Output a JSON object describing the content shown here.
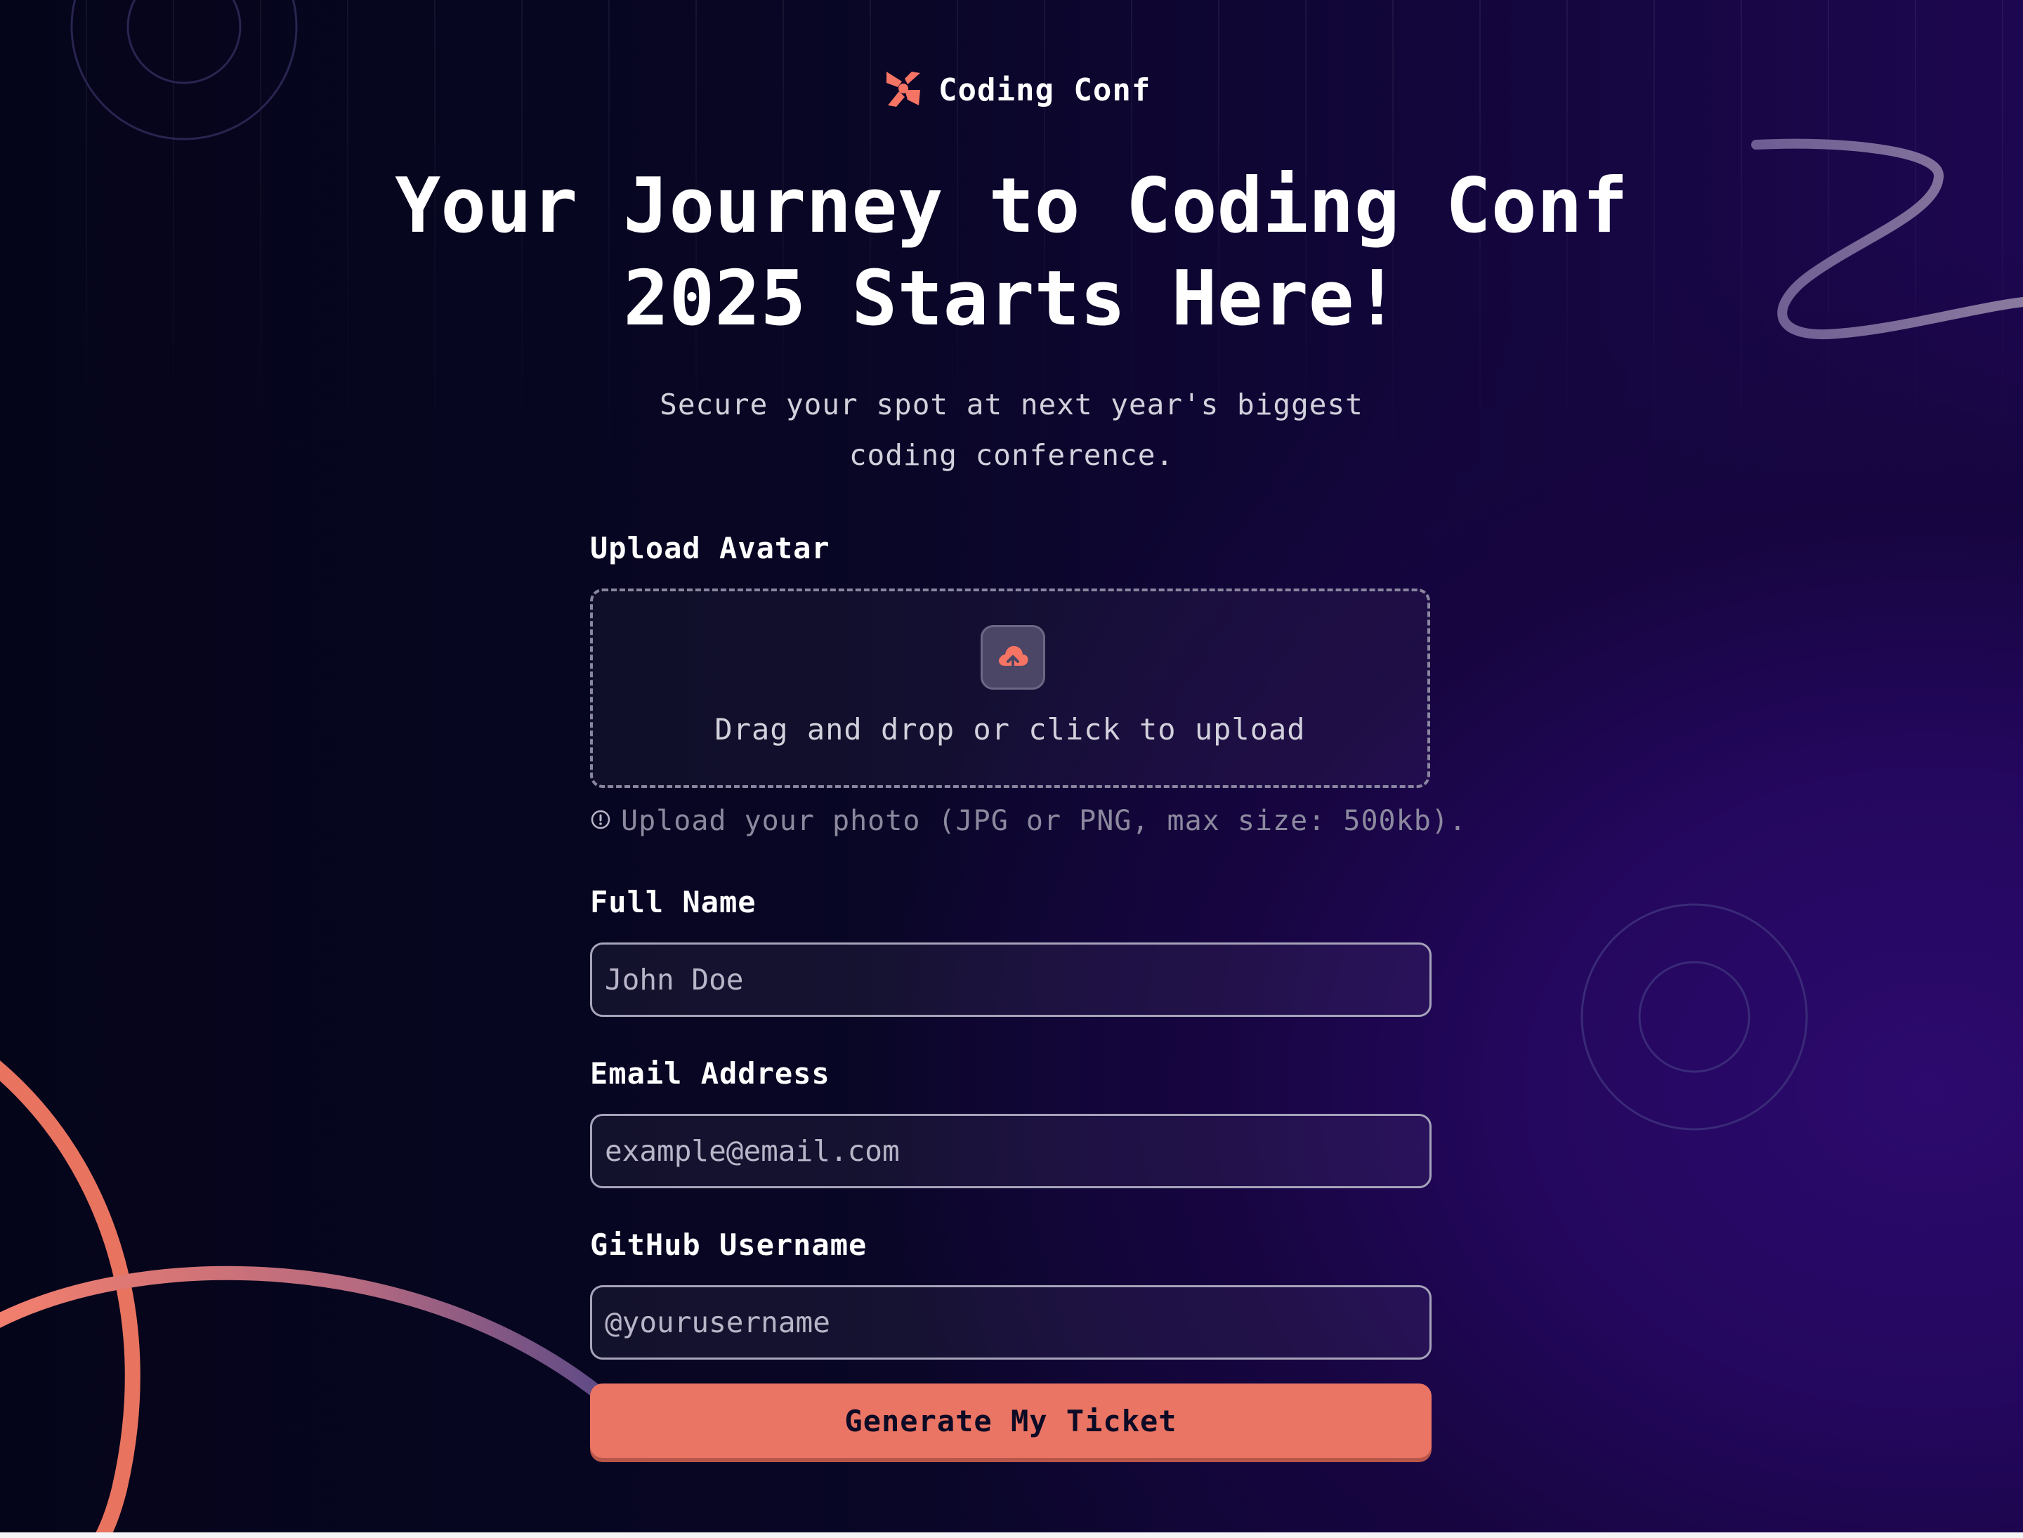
{
  "brand": {
    "name": "Coding Conf",
    "icon": "logo-mark-icon",
    "color": "#f57463"
  },
  "hero": {
    "title": "Your Journey to Coding Conf 2025 Starts Here!",
    "subtitle": "Secure your spot at next year's biggest coding conference."
  },
  "form": {
    "avatar": {
      "label": "Upload Avatar",
      "dropzone_text": "Drag and drop or click to upload",
      "icon": "upload-cloud-icon",
      "hint_icon": "info-icon",
      "hint": "Upload your photo (JPG or PNG, max size: 500kb)."
    },
    "full_name": {
      "label": "Full Name",
      "placeholder": "John Doe",
      "value": ""
    },
    "email": {
      "label": "Email Address",
      "placeholder": "example@email.com",
      "value": ""
    },
    "github": {
      "label": "GitHub Username",
      "placeholder": "@yourusername",
      "value": ""
    },
    "submit_label": "Generate My Ticket"
  },
  "colors": {
    "accent": "#ea7564",
    "background_dark": "#05051a",
    "background_purple": "#2c0a6e"
  }
}
